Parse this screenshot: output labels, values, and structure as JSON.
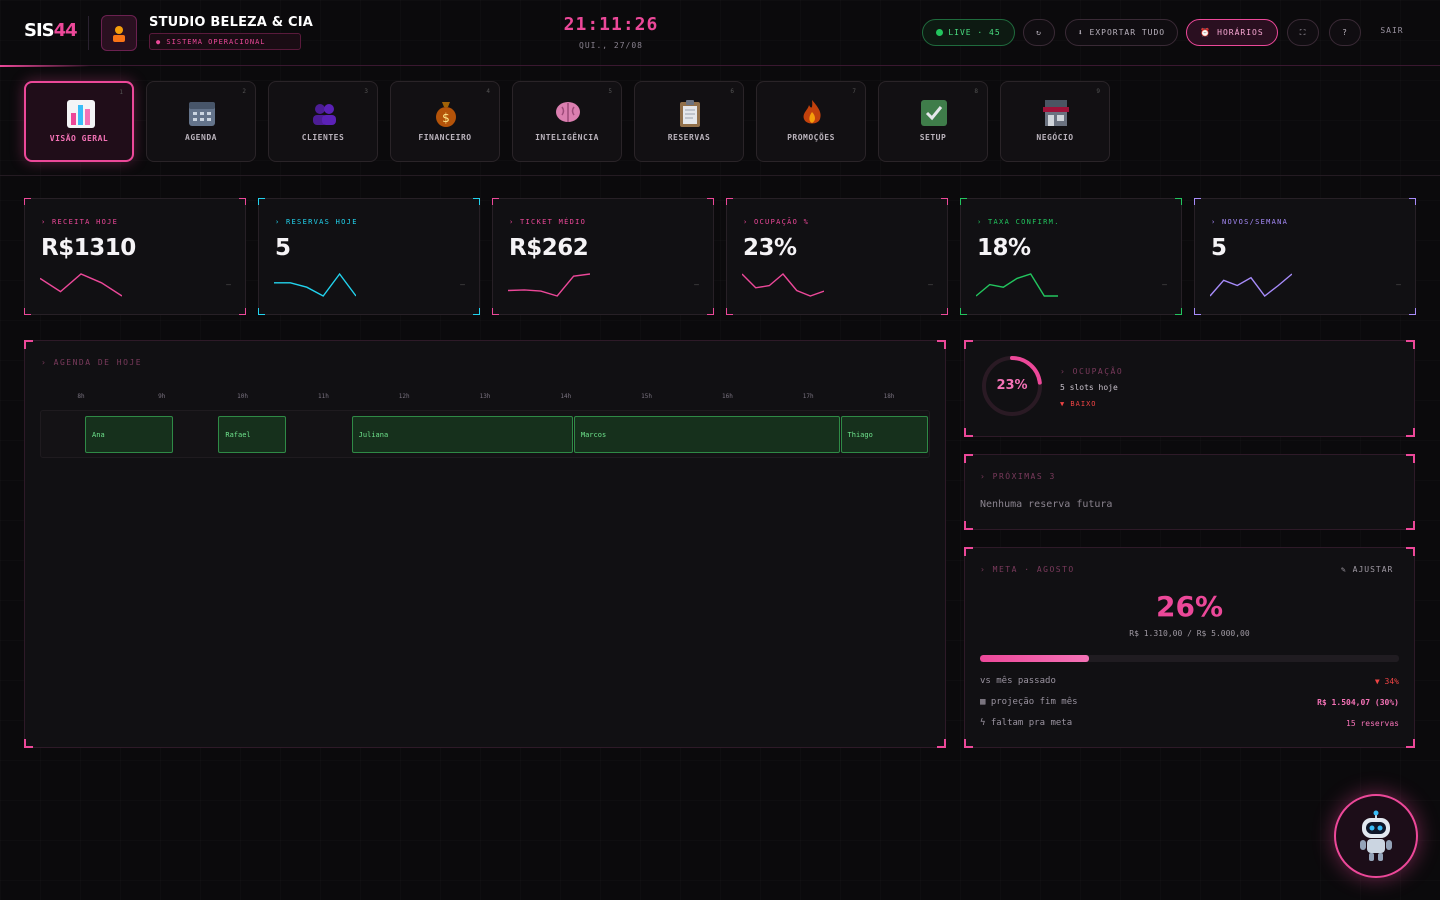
{
  "header": {
    "logo_a": "SIS",
    "logo_b": "44",
    "business_name": "STUDIO BELEZA & CIA",
    "system_status": "● SISTEMA OPERACIONAL",
    "clock": "21:11:26",
    "date": "QUI., 27/08",
    "live_label": "LIVE · 45",
    "refresh_icon": "↻",
    "export_label": "⬇ EXPORTAR TUDO",
    "hours_label": "⏰ HORÁRIOS",
    "fullscreen_icon": "⛶",
    "help_icon": "?",
    "logout_label": "SAIR"
  },
  "nav": [
    {
      "num": "1",
      "label": "VISÃO GERAL",
      "icon": "chart-icon",
      "active": true
    },
    {
      "num": "2",
      "label": "AGENDA",
      "icon": "calendar-icon"
    },
    {
      "num": "3",
      "label": "CLIENTES",
      "icon": "users-icon"
    },
    {
      "num": "4",
      "label": "FINANCEIRO",
      "icon": "money-bag-icon"
    },
    {
      "num": "5",
      "label": "INTELIGÊNCIA",
      "icon": "brain-icon"
    },
    {
      "num": "6",
      "label": "RESERVAS",
      "icon": "clipboard-icon"
    },
    {
      "num": "7",
      "label": "PROMOÇÕES",
      "icon": "fire-icon"
    },
    {
      "num": "8",
      "label": "SETUP",
      "icon": "check-icon"
    },
    {
      "num": "9",
      "label": "NEGÓCIO",
      "icon": "store-icon"
    }
  ],
  "kpis": [
    {
      "label": "› RECEITA HOJE",
      "value": "R$1310",
      "color": "#ec4899",
      "spark": [
        4,
        1,
        5,
        3,
        0
      ]
    },
    {
      "label": "› RESERVAS HOJE",
      "value": "5",
      "color": "#22d3ee",
      "spark": [
        3,
        3,
        2,
        0,
        5,
        0
      ]
    },
    {
      "label": "› TICKET MÉDIO",
      "value": "R$262",
      "color": "#ec4899",
      "spark": [
        1,
        1.1,
        0.9,
        0,
        3.6,
        4
      ]
    },
    {
      "label": "› OCUPAÇÃO %",
      "value": "23%",
      "color": "#ec4899",
      "spark": [
        4,
        1.5,
        1.9,
        4,
        1,
        0,
        0.9
      ]
    },
    {
      "label": "› TAXA CONFIRM.",
      "value": "18%",
      "color": "#22c55e",
      "spark": [
        0,
        1.3,
        1,
        2,
        2.5,
        0,
        0
      ]
    },
    {
      "label": "› NOVOS/SEMANA",
      "value": "5",
      "color": "#a78bfa",
      "spark": [
        0,
        3,
        2,
        3.5,
        0,
        2,
        4.2
      ]
    }
  ],
  "agenda": {
    "title": "› AGENDA DE HOJE",
    "hours": [
      "8h",
      "9h",
      "10h",
      "11h",
      "12h",
      "13h",
      "14h",
      "15h",
      "16h",
      "17h",
      "18h"
    ],
    "bookings": [
      {
        "name": "Ana",
        "start": 8.05,
        "end": 9.15
      },
      {
        "name": "Rafael",
        "start": 9.7,
        "end": 10.55
      },
      {
        "name": "Juliana",
        "start": 11.35,
        "end": 14.1
      },
      {
        "name": "Marcos",
        "start": 14.1,
        "end": 17.4
      },
      {
        "name": "Thiago",
        "start": 17.4,
        "end": 18.5
      }
    ]
  },
  "occupancy": {
    "value": "23%",
    "fraction": 0.23,
    "title": "› OCUPAÇÃO",
    "subtitle": "5 slots hoje",
    "status": "▼ BAIXO"
  },
  "next": {
    "title": "› PRÓXIMAS 3",
    "empty": "Nenhuma reserva futura"
  },
  "goal": {
    "title": "› META · AGOSTO",
    "adjust": "✎ AJUSTAR",
    "percent": "26%",
    "progress": 0.26,
    "amounts": "R$ 1.310,00 / R$ 5.000,00",
    "rows": [
      {
        "label": "vs mês passado",
        "value": "▼ 34%",
        "color": "#ef4444"
      },
      {
        "label": "▦ projeção fim mês",
        "value": "R$ 1.504,07 (30%)",
        "color": "#f472b6"
      },
      {
        "label": "ϟ faltam pra meta",
        "value": "15 reservas",
        "color": "#f472b6"
      }
    ]
  },
  "colors": {
    "accent": "#ec4899",
    "success": "#22c55e",
    "danger": "#ef4444"
  },
  "assistant": {
    "icon": "robot-icon"
  }
}
